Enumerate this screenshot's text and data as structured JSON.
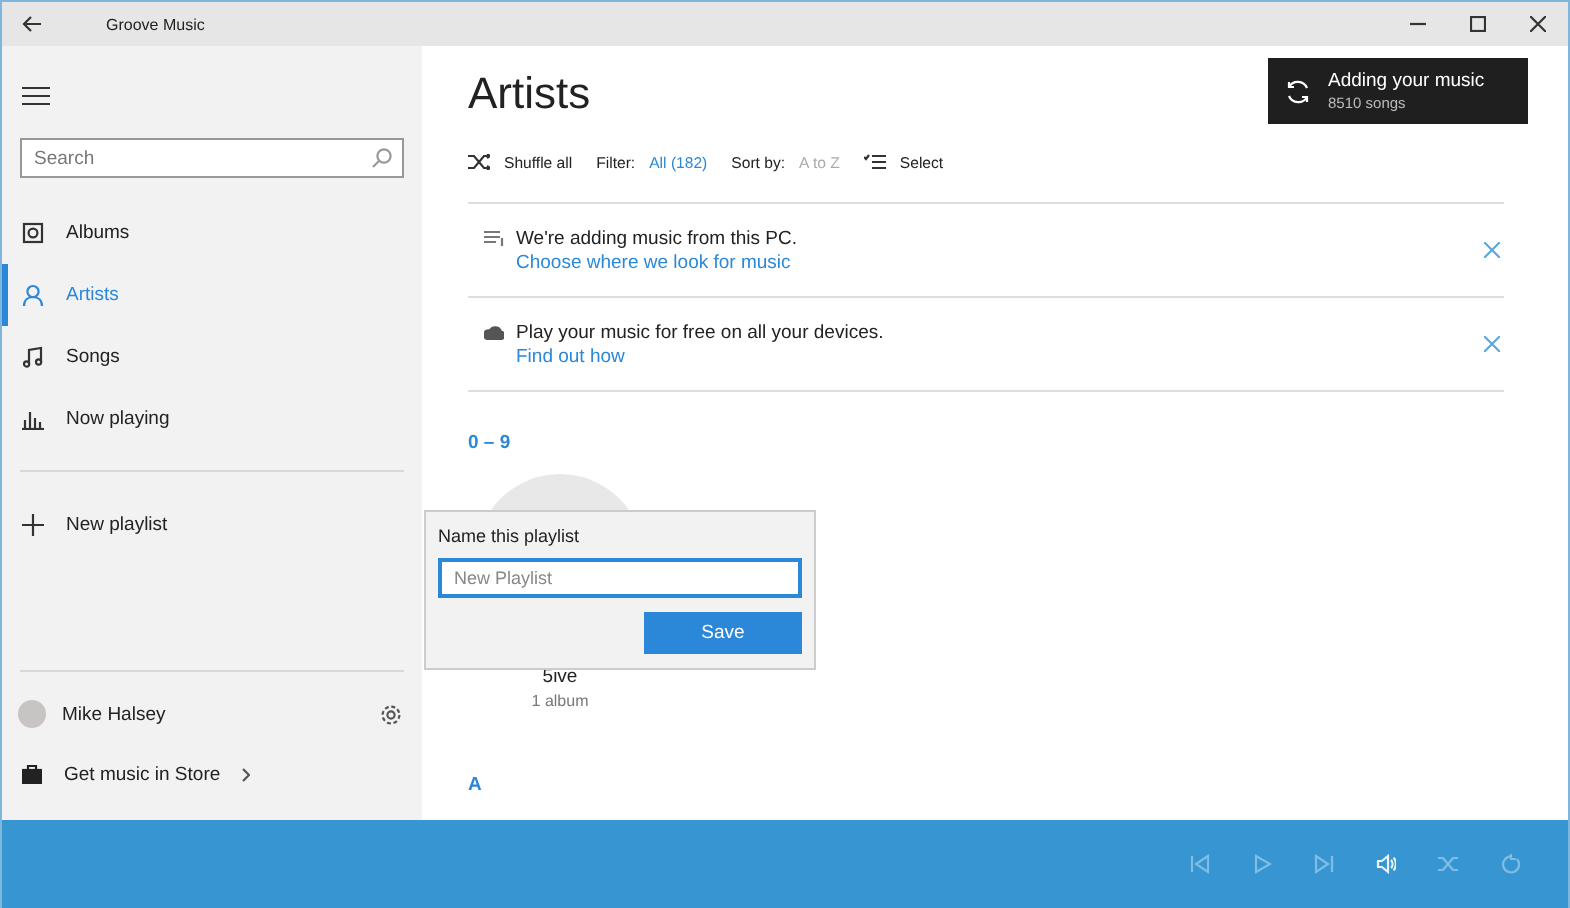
{
  "window": {
    "title": "Groove Music"
  },
  "sidebar": {
    "search": {
      "placeholder": "Search"
    },
    "nav": [
      {
        "label": "Albums",
        "kind": "albums",
        "selected": false
      },
      {
        "label": "Artists",
        "kind": "artists",
        "selected": true
      },
      {
        "label": "Songs",
        "kind": "songs",
        "selected": false
      },
      {
        "label": "Now playing",
        "kind": "nowplaying",
        "selected": false
      }
    ],
    "new_playlist": "New playlist",
    "account": {
      "name": "Mike Halsey"
    },
    "store": "Get music in Store"
  },
  "main": {
    "title": "Artists",
    "toolbar": {
      "shuffle": "Shuffle all",
      "filter_label": "Filter:",
      "filter_value": "All (182)",
      "sort_label": "Sort by:",
      "sort_value": "A to Z",
      "select": "Select"
    },
    "banners": [
      {
        "kind": "adding",
        "text": "We're adding music from this PC.",
        "link": "Choose where we look for music"
      },
      {
        "kind": "cloud",
        "text": "Play your music for free on all your devices.",
        "link": "Find out how"
      }
    ],
    "sections": [
      {
        "heading": "0 – 9",
        "artists": [
          {
            "name": "5ive",
            "detail": "1 album"
          }
        ]
      },
      {
        "heading": "A"
      }
    ]
  },
  "toast": {
    "title": "Adding your music",
    "detail": "8510 songs"
  },
  "dialog": {
    "title": "Name this playlist",
    "placeholder": "New Playlist",
    "button": "Save"
  },
  "player": {
    "controls": [
      {
        "kind": "previous",
        "disabled": true
      },
      {
        "kind": "play",
        "disabled": true
      },
      {
        "kind": "next",
        "disabled": true
      },
      {
        "kind": "volume",
        "disabled": false
      },
      {
        "kind": "shuffle",
        "disabled": true
      },
      {
        "kind": "repeat",
        "disabled": true
      }
    ]
  }
}
